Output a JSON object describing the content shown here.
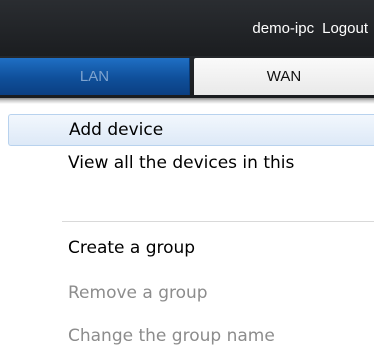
{
  "header": {
    "username": "demo-ipc",
    "logout_label": "Logout"
  },
  "tabs": [
    {
      "label": "LAN",
      "active": false
    },
    {
      "label": "WAN",
      "active": true
    }
  ],
  "context_menu": {
    "items": [
      {
        "label": "Add device",
        "enabled": true,
        "highlighted": true
      },
      {
        "label": "View all the devices in this",
        "enabled": true,
        "highlighted": false
      },
      {
        "label": "Create a group",
        "enabled": true,
        "highlighted": false
      },
      {
        "label": "Remove a group",
        "enabled": false,
        "highlighted": false
      },
      {
        "label": "Change the group name",
        "enabled": false,
        "highlighted": false
      }
    ]
  },
  "colors": {
    "header_bg": "#1b1d20",
    "lan_tab_blue": "#0f4f9a",
    "wan_tab_bg": "#efefef",
    "menu_highlight": "#dde9f7",
    "disabled_text": "#8c8c8c"
  }
}
